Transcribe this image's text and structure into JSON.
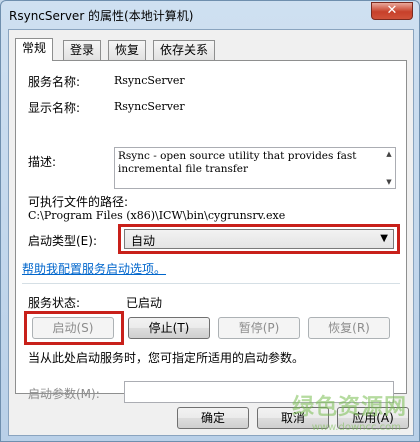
{
  "window": {
    "title": "RsyncServer 的属性(本地计算机)",
    "close_glyph": "✕"
  },
  "tabs": [
    {
      "label": "常规",
      "active": true
    },
    {
      "label": "登录",
      "active": false
    },
    {
      "label": "恢复",
      "active": false
    },
    {
      "label": "依存关系",
      "active": false
    }
  ],
  "general": {
    "service_name_label": "服务名称:",
    "service_name_value": "RsyncServer",
    "display_name_label": "显示名称:",
    "display_name_value": "RsyncServer",
    "description_label": "描述:",
    "description_value": "Rsync - open source utility that provides fast incremental file transfer",
    "exe_path_label": "可执行文件的路径:",
    "exe_path_value": "C:\\Program Files (x86)\\ICW\\bin\\cygrunsrv.exe",
    "startup_type_label": "启动类型(E):",
    "startup_type_value": "自动",
    "help_link": "帮助我配置服务启动选项。",
    "service_status_label": "服务状态:",
    "service_status_value": "已启动",
    "start_button": "启动(S)",
    "stop_button": "停止(T)",
    "pause_button": "暂停(P)",
    "resume_button": "恢复(R)",
    "hint_text": "当从此处启动服务时，您可指定所适用的启动参数。",
    "start_params_label": "启动参数(M):",
    "start_params_value": ""
  },
  "footer": {
    "ok_button": "确定",
    "cancel_button": "取消",
    "apply_button": "应用(A)"
  },
  "watermark": {
    "text": "绿色资源网",
    "sub": "www.downcc.com"
  },
  "colors": {
    "highlight_red": "#c8201a",
    "link_blue": "#0066cc"
  }
}
